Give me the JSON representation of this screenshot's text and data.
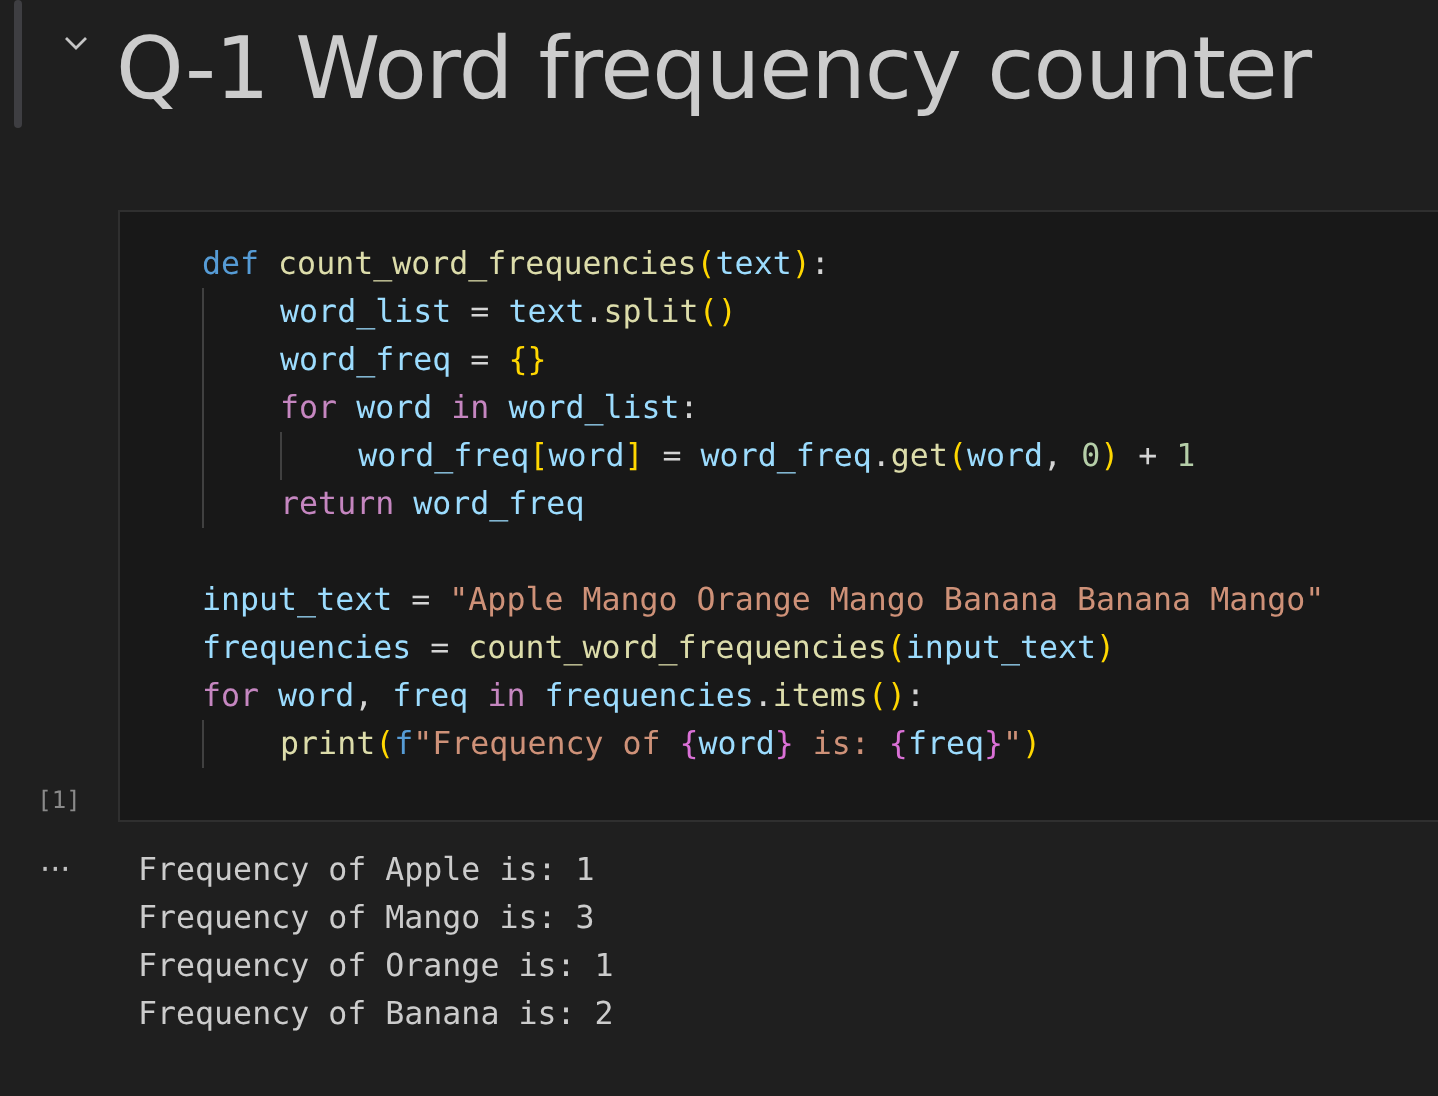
{
  "heading": {
    "text": "Q-1 Word frequency counter",
    "expanded": true
  },
  "code_cell": {
    "execution_count": "[1]",
    "blocks": [
      [
        {
          "tokens": [
            {
              "kind": "keyword",
              "text": "def "
            },
            {
              "kind": "function",
              "text": "count_word_frequencies"
            },
            {
              "kind": "bracket",
              "text": "("
            },
            {
              "kind": "variable",
              "text": "text"
            },
            {
              "kind": "bracket",
              "text": ")"
            },
            {
              "kind": "plain",
              "text": ":"
            }
          ],
          "children": [
            {
              "tokens": [
                {
                  "kind": "variable",
                  "text": "word_list"
                },
                {
                  "kind": "plain",
                  "text": " = "
                },
                {
                  "kind": "variable",
                  "text": "text"
                },
                {
                  "kind": "plain",
                  "text": "."
                },
                {
                  "kind": "function",
                  "text": "split"
                },
                {
                  "kind": "bracket",
                  "text": "()"
                }
              ]
            },
            {
              "tokens": [
                {
                  "kind": "variable",
                  "text": "word_freq"
                },
                {
                  "kind": "plain",
                  "text": " = "
                },
                {
                  "kind": "bracket",
                  "text": "{}"
                }
              ]
            },
            {
              "tokens": [
                {
                  "kind": "control",
                  "text": "for "
                },
                {
                  "kind": "variable",
                  "text": "word "
                },
                {
                  "kind": "control",
                  "text": "in "
                },
                {
                  "kind": "variable",
                  "text": "word_list"
                },
                {
                  "kind": "plain",
                  "text": ":"
                }
              ],
              "children": [
                {
                  "tokens": [
                    {
                      "kind": "variable",
                      "text": "word_freq"
                    },
                    {
                      "kind": "bracket",
                      "text": "["
                    },
                    {
                      "kind": "variable",
                      "text": "word"
                    },
                    {
                      "kind": "bracket",
                      "text": "]"
                    },
                    {
                      "kind": "plain",
                      "text": " = "
                    },
                    {
                      "kind": "variable",
                      "text": "word_freq"
                    },
                    {
                      "kind": "plain",
                      "text": "."
                    },
                    {
                      "kind": "function",
                      "text": "get"
                    },
                    {
                      "kind": "bracket",
                      "text": "("
                    },
                    {
                      "kind": "variable",
                      "text": "word"
                    },
                    {
                      "kind": "plain",
                      "text": ", "
                    },
                    {
                      "kind": "number",
                      "text": "0"
                    },
                    {
                      "kind": "bracket",
                      "text": ")"
                    },
                    {
                      "kind": "plain",
                      "text": " + "
                    },
                    {
                      "kind": "number",
                      "text": "1"
                    }
                  ]
                }
              ]
            },
            {
              "tokens": [
                {
                  "kind": "control",
                  "text": "return "
                },
                {
                  "kind": "variable",
                  "text": "word_freq"
                }
              ]
            }
          ]
        }
      ],
      [
        {
          "tokens": [
            {
              "kind": "variable",
              "text": "input_text"
            },
            {
              "kind": "plain",
              "text": " = "
            },
            {
              "kind": "string",
              "text": "\"Apple Mango Orange Mango Banana Banana Mango\""
            }
          ]
        },
        {
          "tokens": [
            {
              "kind": "variable",
              "text": "frequencies"
            },
            {
              "kind": "plain",
              "text": " = "
            },
            {
              "kind": "function",
              "text": "count_word_frequencies"
            },
            {
              "kind": "bracket",
              "text": "("
            },
            {
              "kind": "variable",
              "text": "input_text"
            },
            {
              "kind": "bracket",
              "text": ")"
            }
          ]
        },
        {
          "tokens": [
            {
              "kind": "control",
              "text": "for "
            },
            {
              "kind": "variable",
              "text": "word"
            },
            {
              "kind": "plain",
              "text": ", "
            },
            {
              "kind": "variable",
              "text": "freq "
            },
            {
              "kind": "control",
              "text": "in "
            },
            {
              "kind": "variable",
              "text": "frequencies"
            },
            {
              "kind": "plain",
              "text": "."
            },
            {
              "kind": "function",
              "text": "items"
            },
            {
              "kind": "bracket",
              "text": "()"
            },
            {
              "kind": "plain",
              "text": ":"
            }
          ],
          "children": [
            {
              "tokens": [
                {
                  "kind": "function",
                  "text": "print"
                },
                {
                  "kind": "bracket",
                  "text": "("
                },
                {
                  "kind": "keyword",
                  "text": "f"
                },
                {
                  "kind": "string",
                  "text": "\"Frequency of "
                },
                {
                  "kind": "brace",
                  "text": "{"
                },
                {
                  "kind": "variable",
                  "text": "word"
                },
                {
                  "kind": "brace",
                  "text": "}"
                },
                {
                  "kind": "string",
                  "text": " is: "
                },
                {
                  "kind": "brace",
                  "text": "{"
                },
                {
                  "kind": "variable",
                  "text": "freq"
                },
                {
                  "kind": "brace",
                  "text": "}"
                },
                {
                  "kind": "string",
                  "text": "\""
                },
                {
                  "kind": "bracket",
                  "text": ")"
                }
              ]
            }
          ]
        }
      ]
    ]
  },
  "output": {
    "menu": "···",
    "lines": [
      "Frequency of Apple is: 1",
      "Frequency of Mango is: 3",
      "Frequency of Orange is: 1",
      "Frequency of Banana is: 2"
    ]
  }
}
